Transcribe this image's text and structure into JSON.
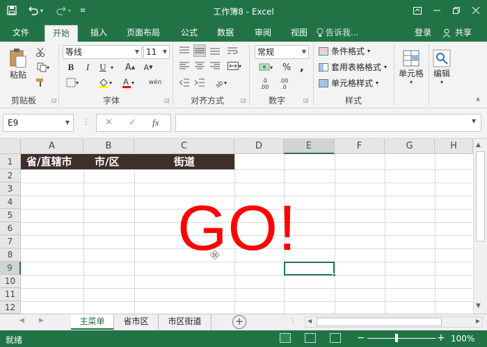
{
  "titlebar": {
    "title": "工作簿8 - Excel",
    "save_icon": "save-icon",
    "undo_icon": "undo-icon",
    "redo_icon": "redo-icon"
  },
  "tabs": {
    "items": [
      "文件",
      "开始",
      "插入",
      "页面布局",
      "公式",
      "数据",
      "审阅",
      "视图"
    ],
    "active_index": 1,
    "tell_me": "告诉我...",
    "login": "登录",
    "share": "共享"
  },
  "ribbon": {
    "clipboard": {
      "label": "剪贴板",
      "paste": "粘贴"
    },
    "font": {
      "label": "字体",
      "name": "等线",
      "size": "11",
      "bold": "B",
      "italic": "I",
      "underline": "U"
    },
    "alignment": {
      "label": "对齐方式"
    },
    "number": {
      "label": "数字",
      "format": "常规"
    },
    "styles": {
      "label": "样式",
      "conditional": "条件格式",
      "table": "套用表格格式",
      "cell_styles": "单元格样式"
    },
    "cells": {
      "label": "单元格"
    },
    "editing": {
      "label": "编辑"
    }
  },
  "formula_bar": {
    "name_box": "E9",
    "fx": "fx",
    "value": ""
  },
  "sheet": {
    "columns": [
      "A",
      "B",
      "C",
      "D",
      "E",
      "F",
      "G",
      "H"
    ],
    "selected_column": "E",
    "rows": [
      "1",
      "2",
      "3",
      "4",
      "5",
      "6",
      "7",
      "8",
      "9",
      "10",
      "11",
      "12"
    ],
    "selected_row": "9",
    "header_cells": [
      "省/直辖市",
      "市/区",
      "街道"
    ],
    "header_fill": "#3f2f2b",
    "overlay_text": "GO!",
    "overlay_color": "#ff0000"
  },
  "sheet_tabs": {
    "items": [
      "主菜单",
      "省市区",
      "市区街道"
    ],
    "active_index": 0
  },
  "status": {
    "text": "就绪",
    "zoom": "100%"
  },
  "colors": {
    "accent": "#217346"
  }
}
